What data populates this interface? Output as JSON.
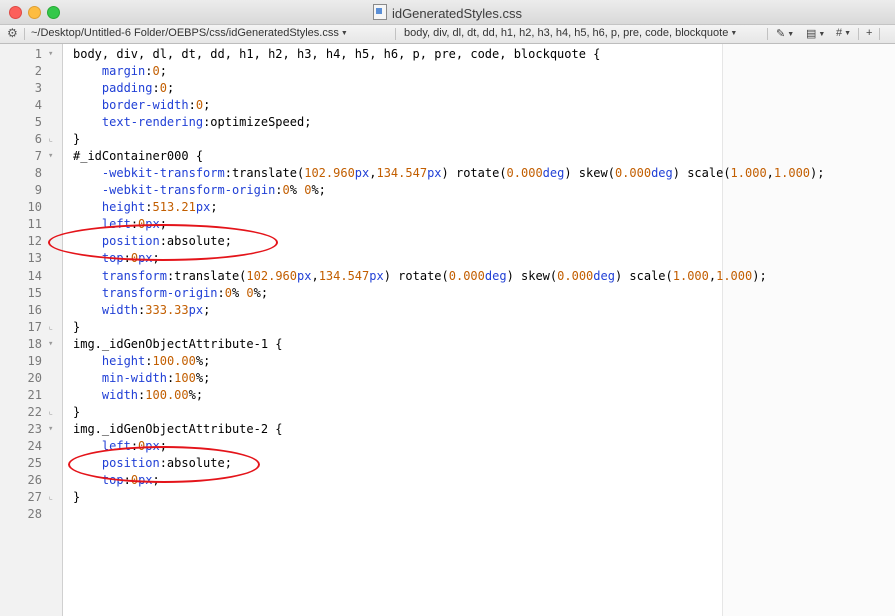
{
  "window": {
    "title": "idGeneratedStyles.css",
    "path": "~/Desktop/Untitled-6 Folder/OEBPS/css/idGeneratedStyles.css",
    "symbol": "body, div, dl, dt, dd, h1, h2, h3, h4, h5, h6, p, pre, code, blockquote",
    "nav_icons": [
      "pencil-icon",
      "document-icon",
      "hash-icon",
      "add-pane-icon"
    ],
    "hash_label": "#",
    "plus_label": "+"
  },
  "colors": {
    "property": "#2140d6",
    "number": "#c25e00",
    "annotation": "#e4141a"
  },
  "lines": [
    {
      "n": "1",
      "fold": "▾",
      "tokens": [
        {
          "t": "body, div, dl, dt, dd, h1, h2, h3, h4, h5, h6, p, pre, code, blockquote {",
          "c": ""
        }
      ]
    },
    {
      "n": "2",
      "fold": "",
      "tokens": [
        {
          "t": "    ",
          "c": ""
        },
        {
          "t": "margin",
          "c": "prop"
        },
        {
          "t": ":",
          "c": ""
        },
        {
          "t": "0",
          "c": "num"
        },
        {
          "t": ";",
          "c": ""
        }
      ]
    },
    {
      "n": "3",
      "fold": "",
      "tokens": [
        {
          "t": "    ",
          "c": ""
        },
        {
          "t": "padding",
          "c": "prop"
        },
        {
          "t": ":",
          "c": ""
        },
        {
          "t": "0",
          "c": "num"
        },
        {
          "t": ";",
          "c": ""
        }
      ]
    },
    {
      "n": "4",
      "fold": "",
      "tokens": [
        {
          "t": "    ",
          "c": ""
        },
        {
          "t": "border-width",
          "c": "prop"
        },
        {
          "t": ":",
          "c": ""
        },
        {
          "t": "0",
          "c": "num"
        },
        {
          "t": ";",
          "c": ""
        }
      ]
    },
    {
      "n": "5",
      "fold": "",
      "tokens": [
        {
          "t": "    ",
          "c": ""
        },
        {
          "t": "text-rendering",
          "c": "prop"
        },
        {
          "t": ":optimizeSpeed;",
          "c": ""
        }
      ]
    },
    {
      "n": "6",
      "fold": "⌞",
      "tokens": [
        {
          "t": "}",
          "c": ""
        }
      ]
    },
    {
      "n": "7",
      "fold": "▾",
      "tokens": [
        {
          "t": "#_idContainer000 {",
          "c": ""
        }
      ]
    },
    {
      "n": "8",
      "fold": "",
      "tokens": [
        {
          "t": "    ",
          "c": ""
        },
        {
          "t": "-webkit-transform",
          "c": "prop"
        },
        {
          "t": ":translate(",
          "c": ""
        },
        {
          "t": "102.960",
          "c": "num"
        },
        {
          "t": "px",
          "c": "prop"
        },
        {
          "t": ",",
          "c": ""
        },
        {
          "t": "134.547",
          "c": "num"
        },
        {
          "t": "px",
          "c": "prop"
        },
        {
          "t": ") rotate(",
          "c": ""
        },
        {
          "t": "0.000",
          "c": "num"
        },
        {
          "t": "deg",
          "c": "prop"
        },
        {
          "t": ") skew(",
          "c": ""
        },
        {
          "t": "0.000",
          "c": "num"
        },
        {
          "t": "deg",
          "c": "prop"
        },
        {
          "t": ") scale(",
          "c": ""
        },
        {
          "t": "1.000",
          "c": "num"
        },
        {
          "t": ",",
          "c": ""
        },
        {
          "t": "1.000",
          "c": "num"
        },
        {
          "t": ");",
          "c": ""
        }
      ]
    },
    {
      "n": "9",
      "fold": "",
      "tokens": [
        {
          "t": "    ",
          "c": ""
        },
        {
          "t": "-webkit-transform-origin",
          "c": "prop"
        },
        {
          "t": ":",
          "c": ""
        },
        {
          "t": "0",
          "c": "num"
        },
        {
          "t": "% ",
          "c": ""
        },
        {
          "t": "0",
          "c": "num"
        },
        {
          "t": "%;",
          "c": ""
        }
      ]
    },
    {
      "n": "10",
      "fold": "",
      "tokens": [
        {
          "t": "    ",
          "c": ""
        },
        {
          "t": "height",
          "c": "prop"
        },
        {
          "t": ":",
          "c": ""
        },
        {
          "t": "513.21",
          "c": "num"
        },
        {
          "t": "px",
          "c": "prop"
        },
        {
          "t": ";",
          "c": ""
        }
      ]
    },
    {
      "n": "11",
      "fold": "",
      "tokens": [
        {
          "t": "    ",
          "c": ""
        },
        {
          "t": "left",
          "c": "prop"
        },
        {
          "t": ":",
          "c": ""
        },
        {
          "t": "0",
          "c": "num"
        },
        {
          "t": "px",
          "c": "prop"
        },
        {
          "t": ";",
          "c": ""
        }
      ]
    },
    {
      "n": "12",
      "fold": "",
      "tokens": [
        {
          "t": "    ",
          "c": ""
        },
        {
          "t": "position",
          "c": "prop"
        },
        {
          "t": ":absolute;",
          "c": ""
        }
      ]
    },
    {
      "n": "13",
      "fold": "",
      "tokens": [
        {
          "t": "    ",
          "c": ""
        },
        {
          "t": "top",
          "c": "prop"
        },
        {
          "t": ":",
          "c": ""
        },
        {
          "t": "0",
          "c": "num"
        },
        {
          "t": "px",
          "c": "prop"
        },
        {
          "t": ";",
          "c": ""
        }
      ]
    },
    {
      "n": "14",
      "fold": "",
      "tokens": [
        {
          "t": "    ",
          "c": ""
        },
        {
          "t": "transform",
          "c": "prop"
        },
        {
          "t": ":translate(",
          "c": ""
        },
        {
          "t": "102.960",
          "c": "num"
        },
        {
          "t": "px",
          "c": "prop"
        },
        {
          "t": ",",
          "c": ""
        },
        {
          "t": "134.547",
          "c": "num"
        },
        {
          "t": "px",
          "c": "prop"
        },
        {
          "t": ") rotate(",
          "c": ""
        },
        {
          "t": "0.000",
          "c": "num"
        },
        {
          "t": "deg",
          "c": "prop"
        },
        {
          "t": ") skew(",
          "c": ""
        },
        {
          "t": "0.000",
          "c": "num"
        },
        {
          "t": "deg",
          "c": "prop"
        },
        {
          "t": ") scale(",
          "c": ""
        },
        {
          "t": "1.000",
          "c": "num"
        },
        {
          "t": ",",
          "c": ""
        },
        {
          "t": "1.000",
          "c": "num"
        },
        {
          "t": ");",
          "c": ""
        }
      ]
    },
    {
      "n": "15",
      "fold": "",
      "tokens": [
        {
          "t": "    ",
          "c": ""
        },
        {
          "t": "transform-origin",
          "c": "prop"
        },
        {
          "t": ":",
          "c": ""
        },
        {
          "t": "0",
          "c": "num"
        },
        {
          "t": "% ",
          "c": ""
        },
        {
          "t": "0",
          "c": "num"
        },
        {
          "t": "%;",
          "c": ""
        }
      ]
    },
    {
      "n": "16",
      "fold": "",
      "tokens": [
        {
          "t": "    ",
          "c": ""
        },
        {
          "t": "width",
          "c": "prop"
        },
        {
          "t": ":",
          "c": ""
        },
        {
          "t": "333.33",
          "c": "num"
        },
        {
          "t": "px",
          "c": "prop"
        },
        {
          "t": ";",
          "c": ""
        }
      ]
    },
    {
      "n": "17",
      "fold": "⌞",
      "tokens": [
        {
          "t": "}",
          "c": ""
        }
      ]
    },
    {
      "n": "18",
      "fold": "▾",
      "tokens": [
        {
          "t": "img._idGenObjectAttribute-1 {",
          "c": ""
        }
      ]
    },
    {
      "n": "19",
      "fold": "",
      "tokens": [
        {
          "t": "    ",
          "c": ""
        },
        {
          "t": "height",
          "c": "prop"
        },
        {
          "t": ":",
          "c": ""
        },
        {
          "t": "100.00",
          "c": "num"
        },
        {
          "t": "%;",
          "c": ""
        }
      ]
    },
    {
      "n": "20",
      "fold": "",
      "tokens": [
        {
          "t": "    ",
          "c": ""
        },
        {
          "t": "min-width",
          "c": "prop"
        },
        {
          "t": ":",
          "c": ""
        },
        {
          "t": "100",
          "c": "num"
        },
        {
          "t": "%;",
          "c": ""
        }
      ]
    },
    {
      "n": "21",
      "fold": "",
      "tokens": [
        {
          "t": "    ",
          "c": ""
        },
        {
          "t": "width",
          "c": "prop"
        },
        {
          "t": ":",
          "c": ""
        },
        {
          "t": "100.00",
          "c": "num"
        },
        {
          "t": "%;",
          "c": ""
        }
      ]
    },
    {
      "n": "22",
      "fold": "⌞",
      "tokens": [
        {
          "t": "}",
          "c": ""
        }
      ]
    },
    {
      "n": "23",
      "fold": "▾",
      "tokens": [
        {
          "t": "img._idGenObjectAttribute-2 {",
          "c": ""
        }
      ]
    },
    {
      "n": "24",
      "fold": "",
      "tokens": [
        {
          "t": "    ",
          "c": ""
        },
        {
          "t": "left",
          "c": "prop"
        },
        {
          "t": ":",
          "c": ""
        },
        {
          "t": "0",
          "c": "num"
        },
        {
          "t": "px",
          "c": "prop"
        },
        {
          "t": ";",
          "c": ""
        }
      ]
    },
    {
      "n": "25",
      "fold": "",
      "tokens": [
        {
          "t": "    ",
          "c": ""
        },
        {
          "t": "position",
          "c": "prop"
        },
        {
          "t": ":absolute;",
          "c": ""
        }
      ]
    },
    {
      "n": "26",
      "fold": "",
      "tokens": [
        {
          "t": "    ",
          "c": ""
        },
        {
          "t": "top",
          "c": "prop"
        },
        {
          "t": ":",
          "c": ""
        },
        {
          "t": "0",
          "c": "num"
        },
        {
          "t": "px",
          "c": "prop"
        },
        {
          "t": ";",
          "c": ""
        }
      ]
    },
    {
      "n": "27",
      "fold": "⌞",
      "tokens": [
        {
          "t": "}",
          "c": ""
        }
      ]
    },
    {
      "n": "28",
      "fold": "",
      "tokens": [
        {
          "t": "",
          "c": ""
        }
      ]
    }
  ],
  "annotations": [
    {
      "label_line": "12",
      "shape": "ellipse"
    },
    {
      "label_line": "25",
      "shape": "ellipse"
    }
  ]
}
